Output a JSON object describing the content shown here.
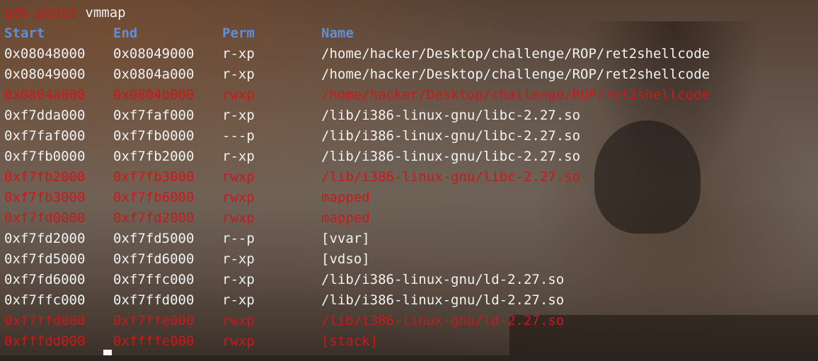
{
  "terminal": {
    "prompt": "gdb-peda$",
    "command": "vmmap",
    "headers": {
      "start": "Start",
      "end": "End",
      "perm": "Perm",
      "name": "Name"
    },
    "rows": [
      {
        "start": "0x08048000",
        "end": "0x08049000",
        "perm": "r-xp",
        "name": "/home/hacker/Desktop/challenge/ROP/ret2shellcode",
        "highlight": false
      },
      {
        "start": "0x08049000",
        "end": "0x0804a000",
        "perm": "r-xp",
        "name": "/home/hacker/Desktop/challenge/ROP/ret2shellcode",
        "highlight": false
      },
      {
        "start": "0x0804a000",
        "end": "0x0804b000",
        "perm": "rwxp",
        "name": "/home/hacker/Desktop/challenge/ROP/ret2shellcode",
        "highlight": true
      },
      {
        "start": "0xf7dda000",
        "end": "0xf7faf000",
        "perm": "r-xp",
        "name": "/lib/i386-linux-gnu/libc-2.27.so",
        "highlight": false
      },
      {
        "start": "0xf7faf000",
        "end": "0xf7fb0000",
        "perm": "---p",
        "name": "/lib/i386-linux-gnu/libc-2.27.so",
        "highlight": false
      },
      {
        "start": "0xf7fb0000",
        "end": "0xf7fb2000",
        "perm": "r-xp",
        "name": "/lib/i386-linux-gnu/libc-2.27.so",
        "highlight": false
      },
      {
        "start": "0xf7fb2000",
        "end": "0xf7fb3000",
        "perm": "rwxp",
        "name": "/lib/i386-linux-gnu/libc-2.27.so",
        "highlight": true
      },
      {
        "start": "0xf7fb3000",
        "end": "0xf7fb6000",
        "perm": "rwxp",
        "name": "mapped",
        "highlight": true
      },
      {
        "start": "0xf7fd0000",
        "end": "0xf7fd2000",
        "perm": "rwxp",
        "name": "mapped",
        "highlight": true
      },
      {
        "start": "0xf7fd2000",
        "end": "0xf7fd5000",
        "perm": "r--p",
        "name": "[vvar]",
        "highlight": false
      },
      {
        "start": "0xf7fd5000",
        "end": "0xf7fd6000",
        "perm": "r-xp",
        "name": "[vdso]",
        "highlight": false
      },
      {
        "start": "0xf7fd6000",
        "end": "0xf7ffc000",
        "perm": "r-xp",
        "name": "/lib/i386-linux-gnu/ld-2.27.so",
        "highlight": false
      },
      {
        "start": "0xf7ffc000",
        "end": "0xf7ffd000",
        "perm": "r-xp",
        "name": "/lib/i386-linux-gnu/ld-2.27.so",
        "highlight": false
      },
      {
        "start": "0xf7ffd000",
        "end": "0xf7ffe000",
        "perm": "rwxp",
        "name": "/lib/i386-linux-gnu/ld-2.27.so",
        "highlight": true
      },
      {
        "start": "0xfffdd000",
        "end": "0xffffe000",
        "perm": "rwxp",
        "name": "[stack]",
        "highlight": true
      }
    ]
  },
  "colors": {
    "prompt": "#c41c1c",
    "header": "#5f8fd6",
    "text": "#f2f2f2",
    "highlight": "#c81a1a"
  }
}
